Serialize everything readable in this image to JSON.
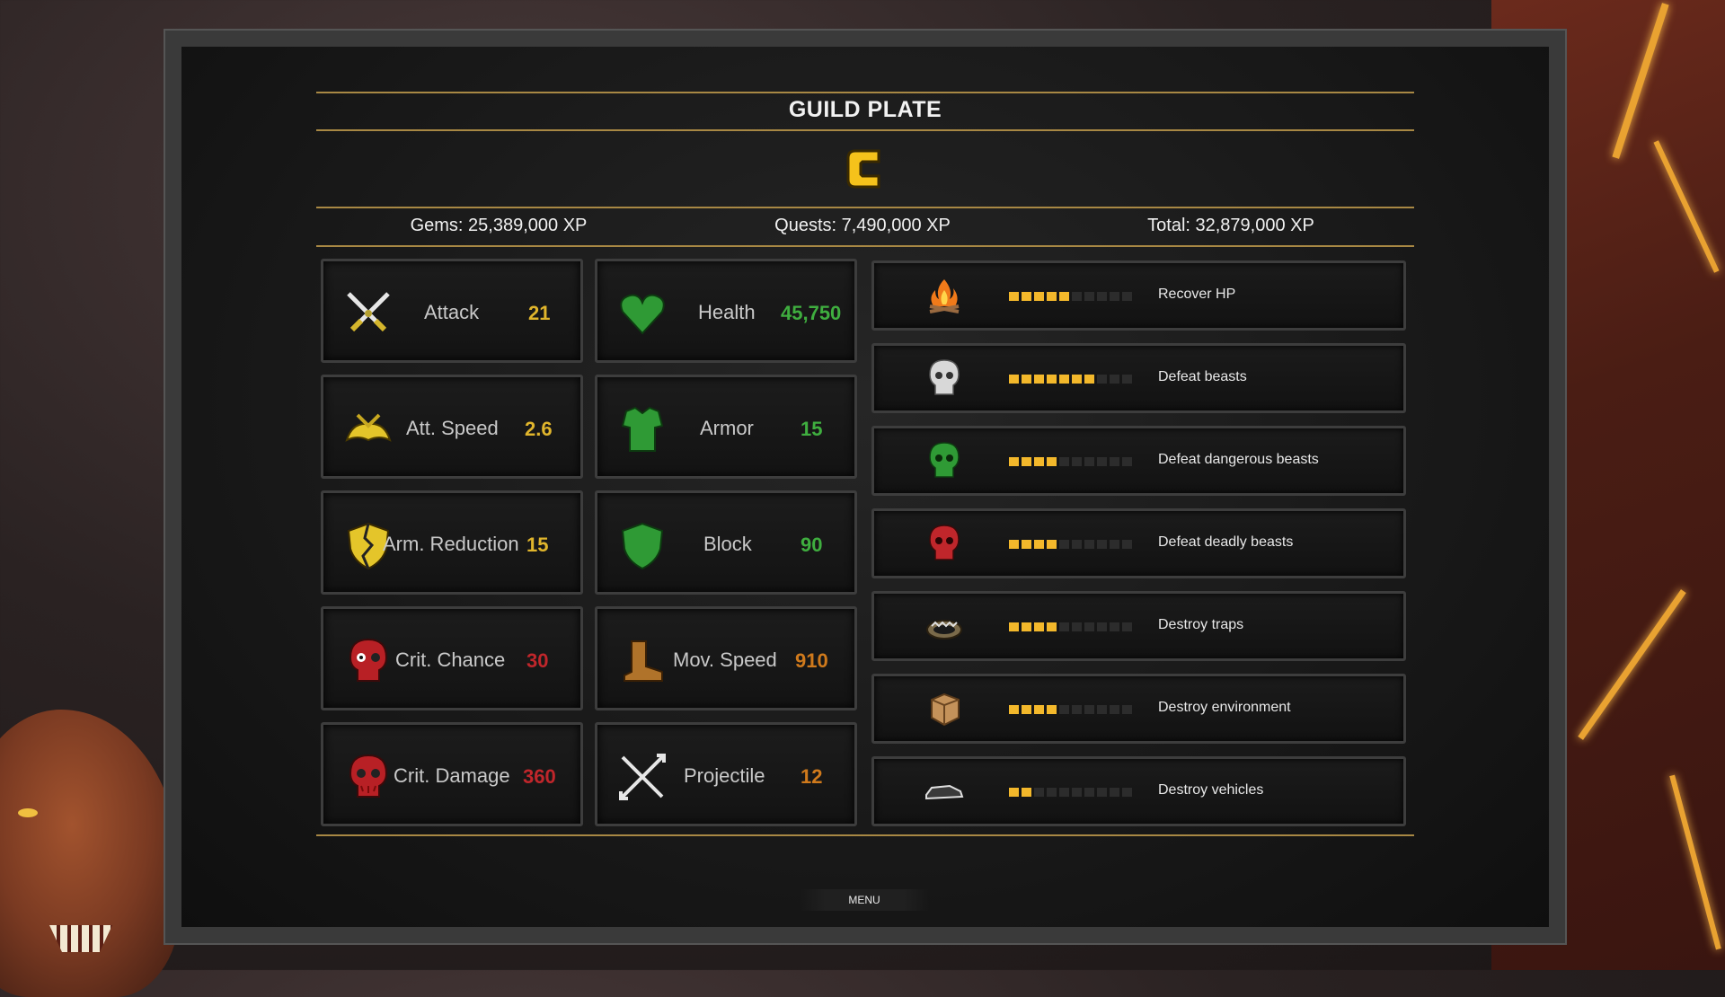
{
  "header": {
    "title": "GUILD PLATE",
    "rank": "C"
  },
  "xp": {
    "gems": "Gems: 25,389,000 XP",
    "quests": "Quests: 7,490,000 XP",
    "total": "Total: 32,879,000 XP"
  },
  "stats": [
    {
      "name": "Attack",
      "value": "21",
      "color": "#e0b52c",
      "icon": "crossed-swords-icon"
    },
    {
      "name": "Health",
      "value": "45,750",
      "color": "#3fae3f",
      "icon": "heart-icon"
    },
    {
      "name": "Att. Speed",
      "value": "2.6",
      "color": "#e0b52c",
      "icon": "winged-speed-icon"
    },
    {
      "name": "Armor",
      "value": "15",
      "color": "#3fae3f",
      "icon": "armor-icon"
    },
    {
      "name": "Arm. Reduction",
      "value": "15",
      "color": "#e0b52c",
      "icon": "broken-shield-icon"
    },
    {
      "name": "Block",
      "value": "90",
      "color": "#3fae3f",
      "icon": "shield-icon"
    },
    {
      "name": "Crit. Chance",
      "value": "30",
      "color": "#c0262b",
      "icon": "crit-skull-icon"
    },
    {
      "name": "Mov. Speed",
      "value": "910",
      "color": "#d07a1c",
      "icon": "boot-icon"
    },
    {
      "name": "Crit. Damage",
      "value": "360",
      "color": "#c0262b",
      "icon": "bloody-skull-icon"
    },
    {
      "name": "Projectile",
      "value": "12",
      "color": "#d07a1c",
      "icon": "crossed-arrows-icon"
    }
  ],
  "objectives": [
    {
      "label": "Recover HP",
      "progress": 5,
      "max": 10,
      "icon": "campfire-icon"
    },
    {
      "label": "Defeat beasts",
      "progress": 7,
      "max": 10,
      "icon": "white-skull-icon"
    },
    {
      "label": "Defeat dangerous beasts",
      "progress": 4,
      "max": 10,
      "icon": "green-skull-icon"
    },
    {
      "label": "Defeat deadly beasts",
      "progress": 4,
      "max": 10,
      "icon": "red-skull-icon"
    },
    {
      "label": "Destroy traps",
      "progress": 4,
      "max": 10,
      "icon": "bear-trap-icon"
    },
    {
      "label": "Destroy environment",
      "progress": 4,
      "max": 10,
      "icon": "crate-icon"
    },
    {
      "label": "Destroy vehicles",
      "progress": 2,
      "max": 10,
      "icon": "car-icon"
    }
  ],
  "footer": {
    "menu_label": "MENU"
  }
}
